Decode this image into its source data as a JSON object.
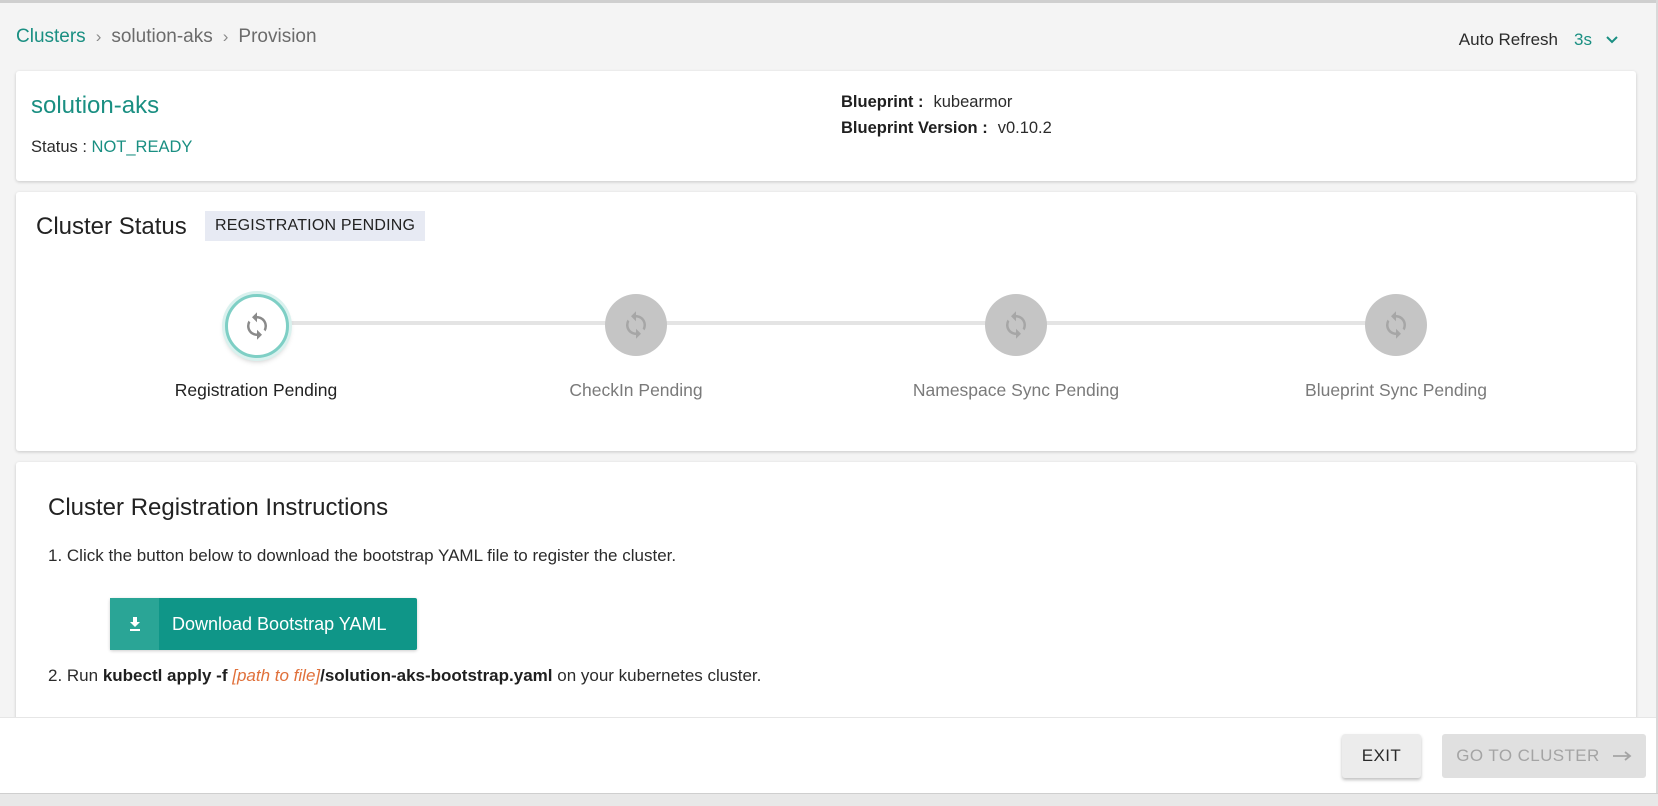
{
  "breadcrumb": {
    "root": "Clusters",
    "cluster": "solution-aks",
    "page": "Provision"
  },
  "auto_refresh": {
    "label": "Auto Refresh",
    "value": "3s"
  },
  "cluster": {
    "name": "solution-aks",
    "status_label": "Status : ",
    "status_value": "NOT_READY",
    "blueprint_label": "Blueprint :",
    "blueprint_value": "kubearmor",
    "blueprint_version_label": "Blueprint Version :",
    "blueprint_version_value": "v0.10.2"
  },
  "cluster_status": {
    "title": "Cluster Status",
    "badge": "REGISTRATION PENDING",
    "steps": [
      {
        "label": "Registration Pending",
        "state": "active"
      },
      {
        "label": "CheckIn Pending",
        "state": "pending"
      },
      {
        "label": "Namespace Sync Pending",
        "state": "pending"
      },
      {
        "label": "Blueprint Sync Pending",
        "state": "pending"
      }
    ]
  },
  "instructions": {
    "title": "Cluster Registration Instructions",
    "step1": "1. Click the button below to download the bootstrap YAML file to register the cluster.",
    "download_label": "Download Bootstrap YAML",
    "step2_prefix": "2. Run ",
    "step2_cmd": "kubectl apply -f ",
    "step2_path": "[path to file]",
    "step2_file": "/solution-aks-bootstrap.yaml",
    "step2_suffix": " on your kubernetes cluster."
  },
  "footer": {
    "exit_label": "EXIT",
    "goto_label": "GO TO CLUSTER"
  },
  "colors": {
    "accent": "#1a8f82",
    "button": "#0f9688",
    "warning_text": "#e0703a"
  },
  "icons": {
    "dropdown": "chevron-down-icon",
    "step": "refresh-icon",
    "download": "download-icon",
    "arrow": "arrow-right-icon"
  }
}
